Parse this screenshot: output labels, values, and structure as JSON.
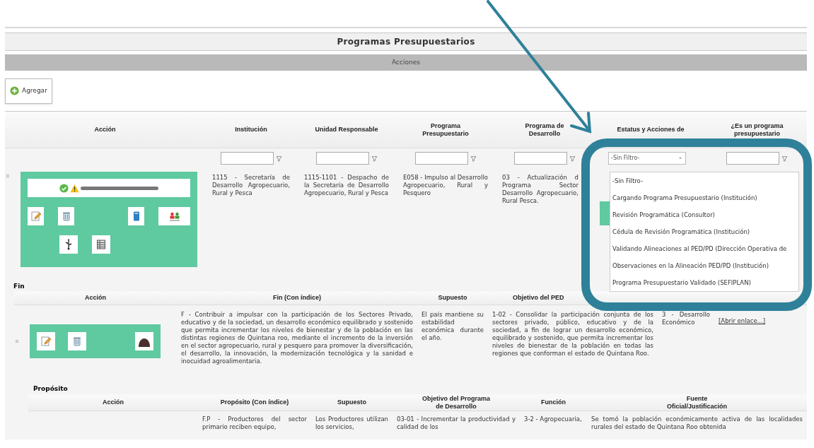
{
  "page": {
    "title": "Programas Presupuestarios",
    "section_bar": "Acciones",
    "add_button": "Agregar"
  },
  "programs_table": {
    "action_header": "Acción",
    "columns": [
      {
        "label": "Institución",
        "filter": {
          "kind": "text"
        }
      },
      {
        "label": "Unidad Responsable",
        "filter": {
          "kind": "text"
        }
      },
      {
        "label": "Programa Presupuestario",
        "filter": {
          "kind": "text"
        }
      },
      {
        "label": "Programa de Desarrollo",
        "filter": {
          "kind": "text"
        }
      },
      {
        "label": "Estatus y Acciones de",
        "filter": {
          "kind": "select",
          "value": "-Sin Filtro-",
          "options": [
            "-Sin Filtro-",
            "Cargando Programa Presupuestario (Institución)",
            "Revisión Programática (Consultor)",
            "Cédula de Revisión Programática (Institución)",
            "Validando Alineaciones al PED/PD (Dirección Operativa de",
            "Observaciones en la Alineación PED/PD (Institución)",
            "Programa Presupuestario Validado (SEFIPLAN)"
          ]
        }
      },
      {
        "label": "¿Es un programa presupuestario",
        "filter": {
          "kind": "text"
        }
      }
    ],
    "rows": [
      {
        "cells": [
          "1115 - Secretaría de Desarrollo Agropecuario, Rural y Pesca",
          "1115-1101 - Despacho de la Secretaría de Desarrollo Agropecuario, Rural y Pesca",
          "E058 - Impulso al Desarrollo Agropecuario, Rural y Pesquero",
          "03 - Actualización d Programa Sector Desarrollo Agropecuario, Rural Pesca."
        ]
      }
    ]
  },
  "fin": {
    "label": "Fin",
    "action_header": "Acción",
    "columns": [
      "Fin (Con índice)",
      "Supuesto",
      "Objetivo del PED"
    ],
    "rows": [
      {
        "cells": [
          "F - Contribuir a impulsar con la participación de los Sectores Privado, educativo y de la sociedad, un desarrollo económico equilibrado y sostenido que permita incrementar los niveles de bienestar y de la población en las distintas regiones de Quintana roo, mediante el incremento de la inversión en el sector agropecuario, rural y pesquero para promover la diversificación, el desarrollo, la innovación, la modernización tecnológica y la sanidad e inocuidad agroalimentaria.",
          "El país mantiene su estabilidad económica durante el año.",
          "1-02 - Consolidar la participación conjunta de los sectores privado, público, educativo y de la sociedad, a fin de lograr un desarrollo económico, equilibrado y sostenido, que permita incrementar los niveles de bienestar de la población en todas las regiones que conforman el estado de Quintana Roo.",
          "3 - Desarrollo Económico"
        ],
        "link": "[Abrir enlace...]"
      }
    ]
  },
  "proposito": {
    "label": "Propósito",
    "action_header": "Acción",
    "columns": [
      "Propósito (Con índice)",
      "Supuesto",
      "Objetivo del Programa de Desarrollo",
      "Función",
      "Fuente Oficial/Justificación"
    ],
    "rows": [
      {
        "cells": [
          "F.P - Productores del sector primario reciben equipo,",
          "Los Productores utilizan los servicios,",
          "03-01 - Incrementar la productividad y calidad de los",
          "3-2 - Agropecuaria,",
          "Se tomó la población económicamente activa de las localidades rurales del estado de Quintana Roo obtenida"
        ]
      }
    ]
  }
}
